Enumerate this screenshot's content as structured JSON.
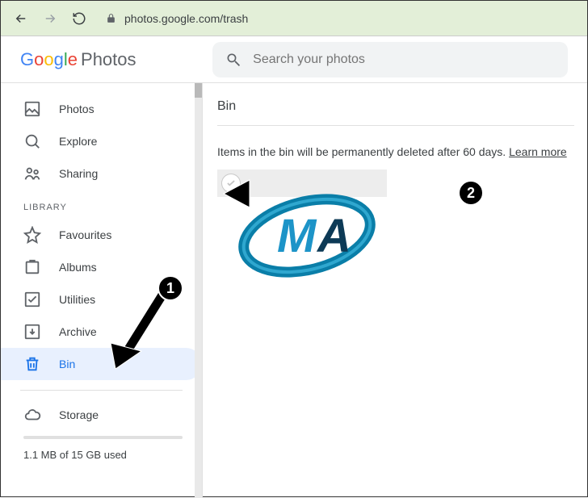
{
  "browser": {
    "url": "photos.google.com/trash"
  },
  "logo": {
    "g": "G",
    "o1": "o",
    "o2": "o",
    "g2": "g",
    "l": "l",
    "e": "e",
    "photos": "Photos"
  },
  "search": {
    "placeholder": "Search your photos"
  },
  "sidebar": {
    "items": [
      {
        "label": "Photos"
      },
      {
        "label": "Explore"
      },
      {
        "label": "Sharing"
      }
    ],
    "section_label": "LIBRARY",
    "library": [
      {
        "label": "Favourites"
      },
      {
        "label": "Albums"
      },
      {
        "label": "Utilities"
      },
      {
        "label": "Archive"
      },
      {
        "label": "Bin"
      }
    ],
    "storage_label": "Storage",
    "storage_text": "1.1 MB of 15 GB used"
  },
  "main": {
    "title": "Bin",
    "notice": "Items in the bin will be permanently deleted after 60 days. ",
    "learn_more": "Learn more"
  },
  "annotations": {
    "one": "1",
    "two": "2"
  }
}
